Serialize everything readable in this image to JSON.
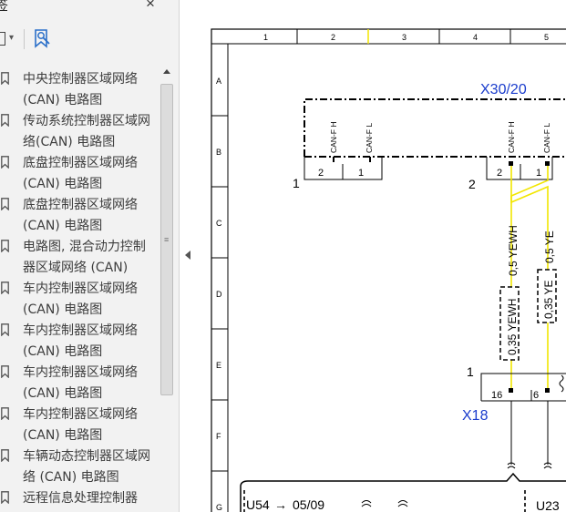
{
  "sidebar": {
    "title": "签",
    "close_glyph": "×",
    "toolbar": {
      "options_caret": "▾"
    },
    "bookmarks": [
      {
        "label": "中央控制器区域网络 (CAN) 电路图"
      },
      {
        "label": "传动系统控制器区域网络(CAN) 电路图"
      },
      {
        "label": "底盘控制器区域网络 (CAN) 电路图"
      },
      {
        "label": "底盘控制器区域网络 (CAN) 电路图"
      },
      {
        "label": "电路图, 混合动力控制器区域网络 (CAN)"
      },
      {
        "label": "车内控制器区域网络 (CAN) 电路图"
      },
      {
        "label": "车内控制器区域网络 (CAN) 电路图"
      },
      {
        "label": "车内控制器区域网络 (CAN) 电路图"
      },
      {
        "label": "车内控制器区域网络 (CAN) 电路图"
      },
      {
        "label": "车辆动态控制器区域网络 (CAN) 电路图"
      },
      {
        "label": "远程信息处理控制器"
      }
    ],
    "scroll_grip": "≡"
  },
  "diagram": {
    "col_numbers": [
      "1",
      "2",
      "3",
      "4",
      "5"
    ],
    "row_letters": [
      "A",
      "B",
      "C",
      "D",
      "E",
      "F",
      "G"
    ],
    "connector_x30_20": "X30/20",
    "pin_can_fh": "CAN-F H",
    "pin_can_fl": "CAN-F L",
    "pin_can_fh_2": "CAN-F H",
    "pin_can_fl_2": "CAN-F L",
    "pin_2a": "2",
    "pin_1a": "1",
    "pin_2b": "2",
    "pin_1b": "1",
    "terminal_1": "1",
    "terminal_2": "2",
    "wire_yewh": "0,5 YEWH",
    "wire_ye": "0,5 YE",
    "wire_yewh_035": "0,35 YEWH",
    "wire_ye_035": "0,35 YE",
    "x18_term": "1",
    "x18_pin16": "16",
    "x18_pin6": "6",
    "connector_x18": "X18",
    "u54": "U54",
    "u54_arrow": "→",
    "u54_ref": "05/09",
    "u23": "U23",
    "wire_color_yellow": "#f2e600",
    "label_blue": "#1a3ccc"
  }
}
